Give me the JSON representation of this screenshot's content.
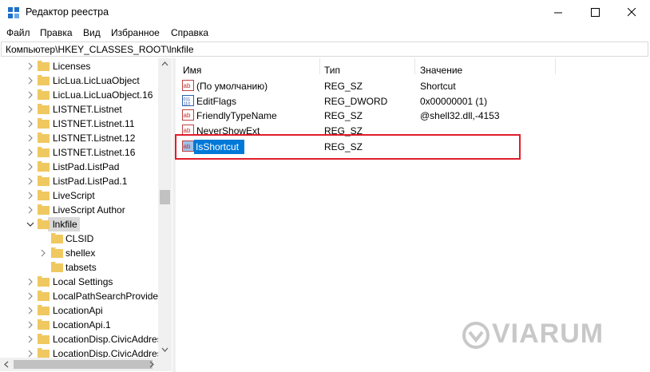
{
  "window": {
    "title": "Редактор реестра"
  },
  "menu": [
    "Файл",
    "Правка",
    "Вид",
    "Избранное",
    "Справка"
  ],
  "address": "Компьютер\\HKEY_CLASSES_ROOT\\lnkfile",
  "tree": [
    {
      "label": "Licenses"
    },
    {
      "label": "LicLua.LicLuaObject"
    },
    {
      "label": "LicLua.LicLuaObject.16"
    },
    {
      "label": "LISTNET.Listnet"
    },
    {
      "label": "LISTNET.Listnet.11"
    },
    {
      "label": "LISTNET.Listnet.12"
    },
    {
      "label": "LISTNET.Listnet.16"
    },
    {
      "label": "ListPad.ListPad"
    },
    {
      "label": "ListPad.ListPad.1"
    },
    {
      "label": "LiveScript"
    },
    {
      "label": "LiveScript Author"
    },
    {
      "label": "lnkfile"
    },
    {
      "label": "CLSID"
    },
    {
      "label": "shellex"
    },
    {
      "label": "tabsets"
    },
    {
      "label": "Local Settings"
    },
    {
      "label": "LocalPathSearchProvider"
    },
    {
      "label": "LocationApi"
    },
    {
      "label": "LocationApi.1"
    },
    {
      "label": "LocationDisp.CivicAddres"
    },
    {
      "label": "LocationDisp.CivicAddres"
    }
  ],
  "columns": {
    "name": "Имя",
    "type": "Тип",
    "data": "Значение"
  },
  "values": [
    {
      "name": "(По умолчанию)",
      "type": "REG_SZ",
      "data": "Shortcut",
      "icon": "string-value-icon"
    },
    {
      "name": "EditFlags",
      "type": "REG_DWORD",
      "data": "0x00000001 (1)",
      "icon": "dword-value-icon"
    },
    {
      "name": "FriendlyTypeName",
      "type": "REG_SZ",
      "data": "@shell32.dll,-4153",
      "icon": "string-value-icon"
    },
    {
      "name": "NeverShowExt",
      "type": "REG_SZ",
      "data": "",
      "icon": "string-value-icon"
    },
    {
      "name": "IsShortcut",
      "type": "REG_SZ",
      "data": "",
      "icon": "string-value-icon"
    }
  ],
  "watermark": "VIARUM",
  "colors": {
    "selection": "#0078d7",
    "highlight_frame": "#e01e2b",
    "folder": "#f0c860"
  }
}
